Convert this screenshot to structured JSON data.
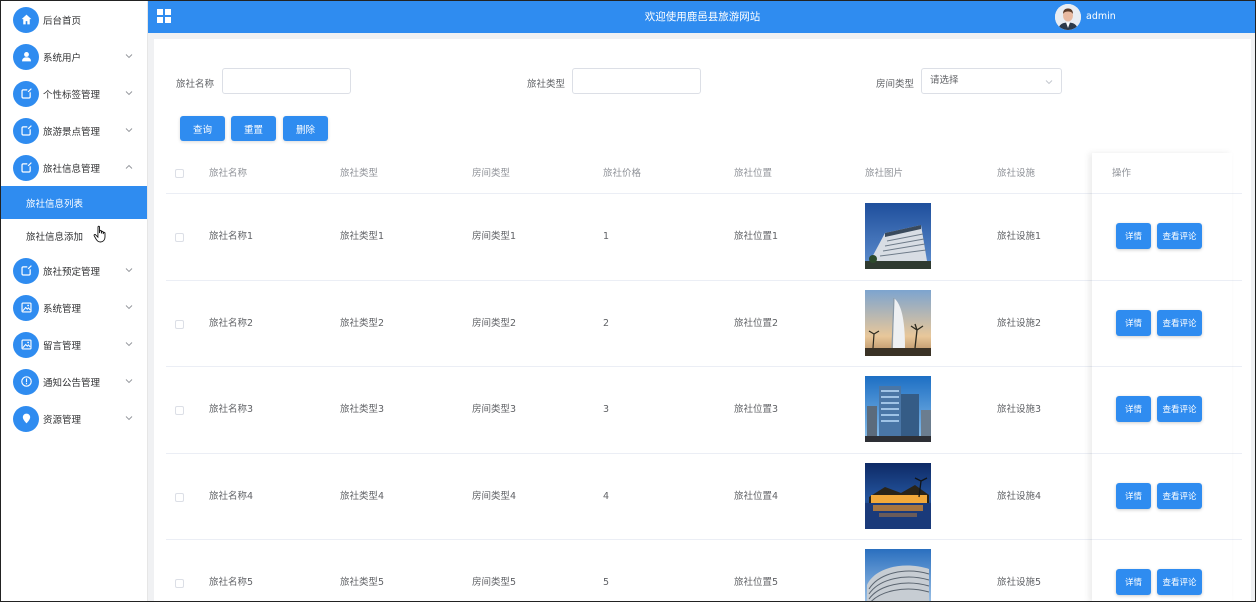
{
  "header": {
    "title": "欢迎使用鹿邑县旅游网站",
    "user": "admin"
  },
  "sidebar": {
    "items": [
      {
        "label": "后台首页",
        "icon": "home-icon"
      },
      {
        "label": "系统用户",
        "icon": "user-icon"
      },
      {
        "label": "个性标签管理",
        "icon": "edit-icon"
      },
      {
        "label": "旅游景点管理",
        "icon": "edit-icon"
      },
      {
        "label": "旅社信息管理",
        "icon": "edit-icon",
        "expanded": true,
        "children": [
          {
            "label": "旅社信息列表",
            "active": true
          },
          {
            "label": "旅社信息添加"
          }
        ]
      },
      {
        "label": "旅社预定管理",
        "icon": "edit-icon"
      },
      {
        "label": "系统管理",
        "icon": "picture-icon"
      },
      {
        "label": "留言管理",
        "icon": "picture-icon"
      },
      {
        "label": "通知公告管理",
        "icon": "info-icon"
      },
      {
        "label": "资源管理",
        "icon": "pin-icon"
      }
    ]
  },
  "search": {
    "name_label": "旅社名称",
    "name_value": "",
    "type_label": "旅社类型",
    "type_value": "",
    "room_label": "房间类型",
    "room_placeholder": "请选择",
    "query": "查询",
    "reset": "重置",
    "delete": "删除"
  },
  "table": {
    "headers": [
      "旅社名称",
      "旅社类型",
      "房间类型",
      "旅社价格",
      "旅社位置",
      "旅社图片",
      "旅社设施",
      "操作"
    ],
    "rows": [
      {
        "name": "旅社名称1",
        "type": "旅社类型1",
        "room": "房间类型1",
        "price": "1",
        "location": "旅社位置1",
        "facility": "旅社设施1"
      },
      {
        "name": "旅社名称2",
        "type": "旅社类型2",
        "room": "房间类型2",
        "price": "2",
        "location": "旅社位置2",
        "facility": "旅社设施2"
      },
      {
        "name": "旅社名称3",
        "type": "旅社类型3",
        "room": "房间类型3",
        "price": "3",
        "location": "旅社位置3",
        "facility": "旅社设施3"
      },
      {
        "name": "旅社名称4",
        "type": "旅社类型4",
        "room": "房间类型4",
        "price": "4",
        "location": "旅社位置4",
        "facility": "旅社设施4"
      },
      {
        "name": "旅社名称5",
        "type": "旅社类型5",
        "room": "房间类型5",
        "price": "5",
        "location": "旅社位置5",
        "facility": "旅社设施5"
      }
    ],
    "detail_btn": "详情",
    "comment_btn": "查看评论"
  },
  "colors": {
    "primary": "#2f8cf0",
    "background": "#f0f1f3"
  }
}
